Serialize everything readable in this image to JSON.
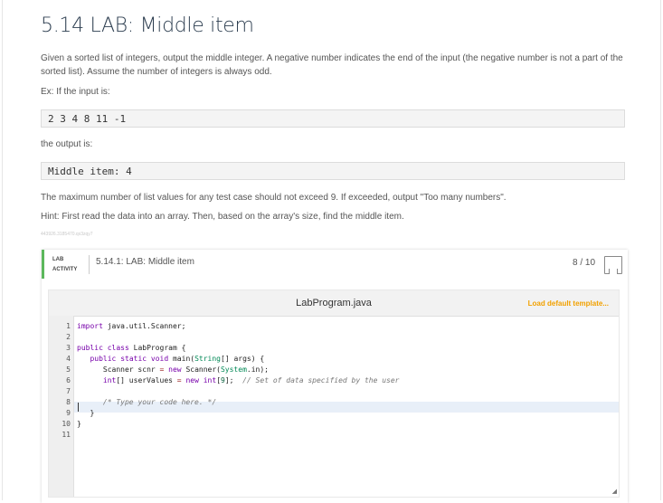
{
  "page": {
    "title": "5.14 LAB: Middle item",
    "description": "Given a sorted list of integers, output the middle integer. A negative number indicates the end of the input (the negative number is not a part of the sorted list). Assume the number of integers is always odd.",
    "example_intro": "Ex: If the input is:",
    "example_input": "2 3 4 8 11 -1",
    "output_intro": "the output is:",
    "example_output": "Middle item: 4",
    "max_note": "The maximum number of list values for any test case should not exceed 9. If exceeded, output \"Too many numbers\".",
    "hint": "Hint: First read the data into an array. Then, based on the array's size, find the middle item.",
    "tracking_id": "443926.3185470.qx3zqy7"
  },
  "lab": {
    "tag_line1": "LAB",
    "tag_line2": "ACTIVITY",
    "title": "5.14.1: LAB: Middle item",
    "score": "8 / 10",
    "file_name": "LabProgram.java",
    "load_template": "Load default template...",
    "accent_color": "#5cb85c",
    "link_color": "#f2a100"
  },
  "code_lines": [
    "import java.util.Scanner;",
    "",
    "public class LabProgram {",
    "   public static void main(String[] args) {",
    "      Scanner scnr = new Scanner(System.in);",
    "      int[] userValues = new int[9];  // Set of data specified by the user",
    "",
    "      /* Type your code here. */",
    "   }",
    "}",
    ""
  ]
}
